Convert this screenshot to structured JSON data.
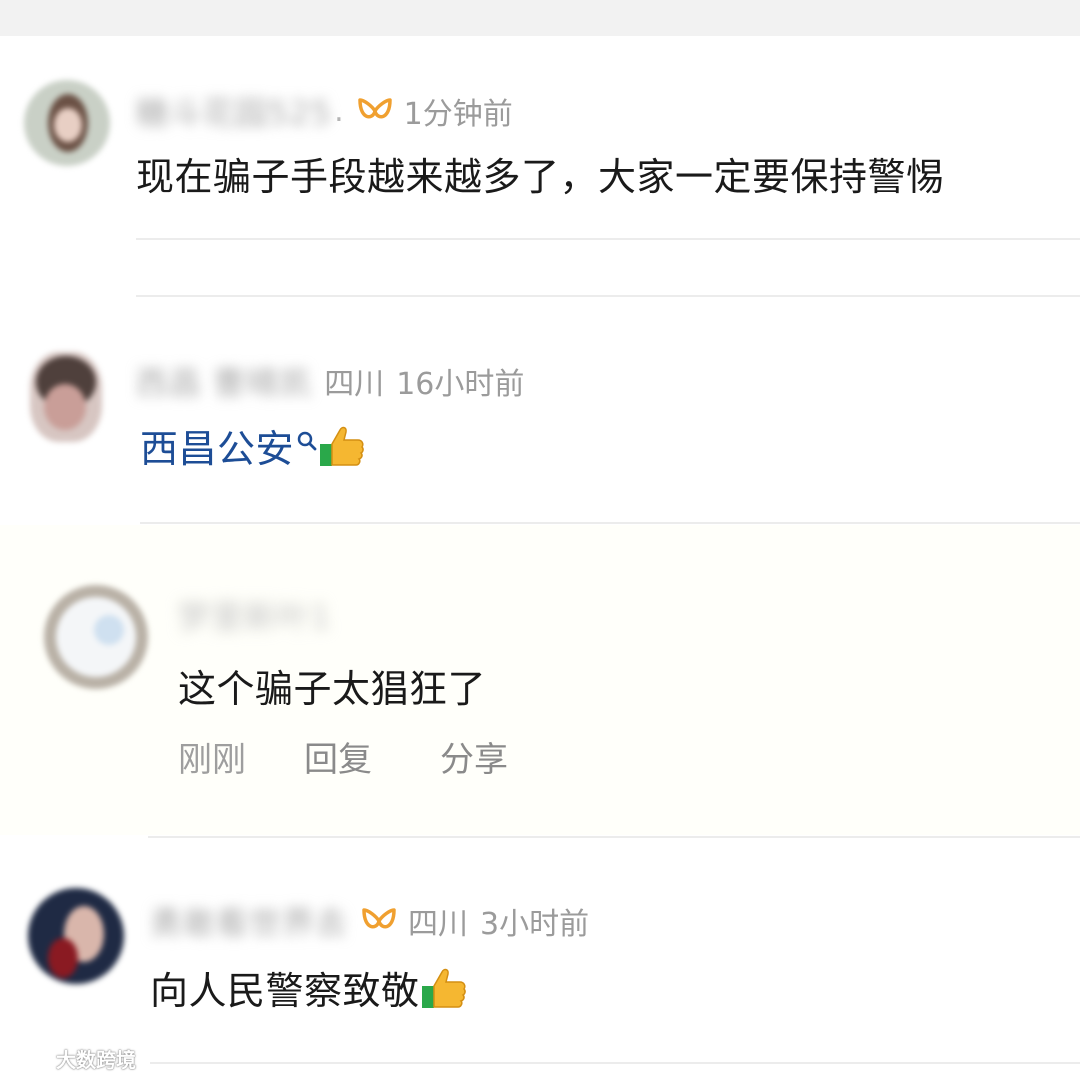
{
  "comments": [
    {
      "username": "糖斗花园525",
      "truncated": true,
      "vip": true,
      "location": "",
      "time": "1分钟前",
      "text": "现在骗子手段越来越多了，大家一定要保持警惕"
    },
    {
      "username": "西昌 曹晴凯",
      "truncated": false,
      "vip": false,
      "location": "四川",
      "time": "16小时前",
      "text": "西昌公安"
    },
    {
      "username": "梦里新叶1",
      "text": "这个骗子太猖狂了",
      "actions": {
        "time": "刚刚",
        "reply": "回复",
        "share": "分享"
      }
    },
    {
      "username": "勇敢看世界去",
      "truncated": false,
      "vip": true,
      "location": "四川",
      "time": "3小时前",
      "text": "向人民警察致敬"
    }
  ],
  "watermark": {
    "text": "大数跨境"
  },
  "colors": {
    "link": "#1d4d96",
    "vip_icon": "#f0a030",
    "meta": "#9b9b9b",
    "text": "#1a1a1a"
  }
}
